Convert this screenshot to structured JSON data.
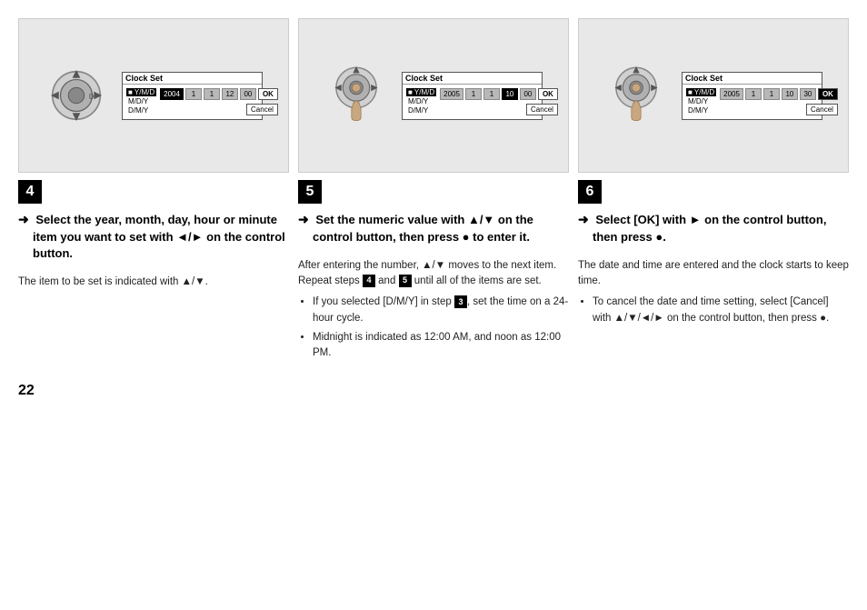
{
  "page": {
    "number": "22"
  },
  "columns": [
    {
      "id": "col1",
      "step_number": "4",
      "screen": {
        "title": "Clock Set",
        "options": [
          "Y/M/D",
          "M/D/Y",
          "D/M/Y"
        ],
        "selected_option": 0,
        "fields": [
          "2004",
          "1",
          "1",
          "12",
          "00"
        ],
        "active_field": 0,
        "ok_label": "OK",
        "cancel_label": "Cancel",
        "ok_active": false
      },
      "instruction": "Select the year, month, day, hour or minute item you want to set with ◄/► on the control button.",
      "detail": "The item to be set is indicated with ▲/▼.",
      "bullets": []
    },
    {
      "id": "col2",
      "step_number": "5",
      "screen": {
        "title": "Clock Set",
        "options": [
          "Y/M/D",
          "M/D/Y",
          "D/M/Y"
        ],
        "selected_option": 0,
        "fields": [
          "2005",
          "1",
          "1",
          "10",
          "00"
        ],
        "active_field": 3,
        "ok_label": "OK",
        "cancel_label": "Cancel",
        "ok_active": false
      },
      "instruction": "Set the numeric value with ▲/▼ on the control button, then press ● to enter it.",
      "detail": "After entering the number, ▲/▼ moves to the next item. Repeat steps",
      "detail_steps": [
        "4",
        "5"
      ],
      "detail_suffix": "until all of the items are set.",
      "bullets": [
        "If you selected [D/M/Y] in step 3, set the time on a 24-hour cycle.",
        "Midnight is indicated as 12:00 AM, and noon as 12:00 PM."
      ]
    },
    {
      "id": "col3",
      "step_number": "6",
      "screen": {
        "title": "Clock Set",
        "options": [
          "Y/M/D",
          "M/D/Y",
          "D/M/Y"
        ],
        "selected_option": 0,
        "fields": [
          "2005",
          "1",
          "1",
          "10",
          "30"
        ],
        "active_field": -1,
        "ok_label": "OK",
        "cancel_label": "Cancel",
        "ok_active": true
      },
      "instruction": "Select [OK] with ► on the control button, then press ●.",
      "detail": "The date and time are entered and the clock starts to keep time.",
      "bullets": [
        "To cancel the date and time setting, select [Cancel] with ▲/▼/◄/► on the control button, then press ●."
      ]
    }
  ]
}
